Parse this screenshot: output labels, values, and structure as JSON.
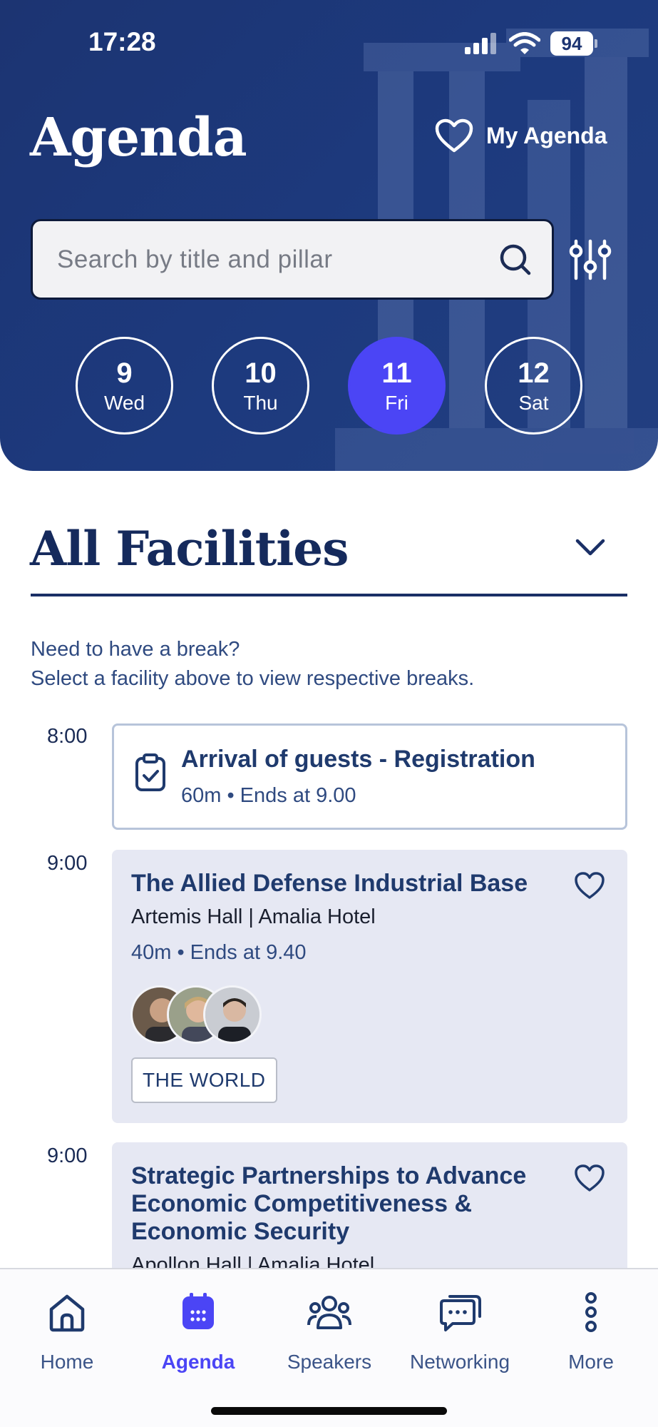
{
  "status_bar": {
    "time": "17:28",
    "battery": "94",
    "icons": [
      "signal-icon",
      "wifi-icon",
      "battery-icon"
    ]
  },
  "header": {
    "title": "Agenda",
    "my_agenda_label": "My Agenda",
    "search_placeholder": "Search by title and pillar"
  },
  "dates": [
    {
      "num": "9",
      "day": "Wed",
      "selected": false
    },
    {
      "num": "10",
      "day": "Thu",
      "selected": false
    },
    {
      "num": "11",
      "day": "Fri",
      "selected": true
    },
    {
      "num": "12",
      "day": "Sat",
      "selected": false
    }
  ],
  "facility": {
    "title": "All Facilities",
    "hint_line1": "Need to have a break?",
    "hint_line2": "Select a facility above to view respective breaks."
  },
  "sessions": [
    {
      "time": "8:00",
      "title": "Arrival of guests - Registration",
      "meta": "60m • Ends at 9.00"
    },
    {
      "time": "9:00",
      "title": "The Allied Defense Industrial Base",
      "venue": "Artemis Hall | Amalia Hotel",
      "meta": "40m • Ends at 9.40",
      "tag": "THE WORLD"
    },
    {
      "time": "9:00",
      "title": "Strategic Partnerships to Advance Economic Competitiveness & Economic Security",
      "venue": "Apollon Hall | Amalia Hotel"
    }
  ],
  "nav": [
    {
      "label": "Home",
      "icon": "home-icon"
    },
    {
      "label": "Agenda",
      "icon": "calendar-icon",
      "active": true
    },
    {
      "label": "Speakers",
      "icon": "people-icon"
    },
    {
      "label": "Networking",
      "icon": "chat-icon"
    },
    {
      "label": "More",
      "icon": "more-icon"
    }
  ],
  "colors": {
    "header_bg": "#1c3472",
    "accent": "#4b45f5",
    "card_bg": "#e6e8f3",
    "text_dark": "#1a2b55"
  }
}
